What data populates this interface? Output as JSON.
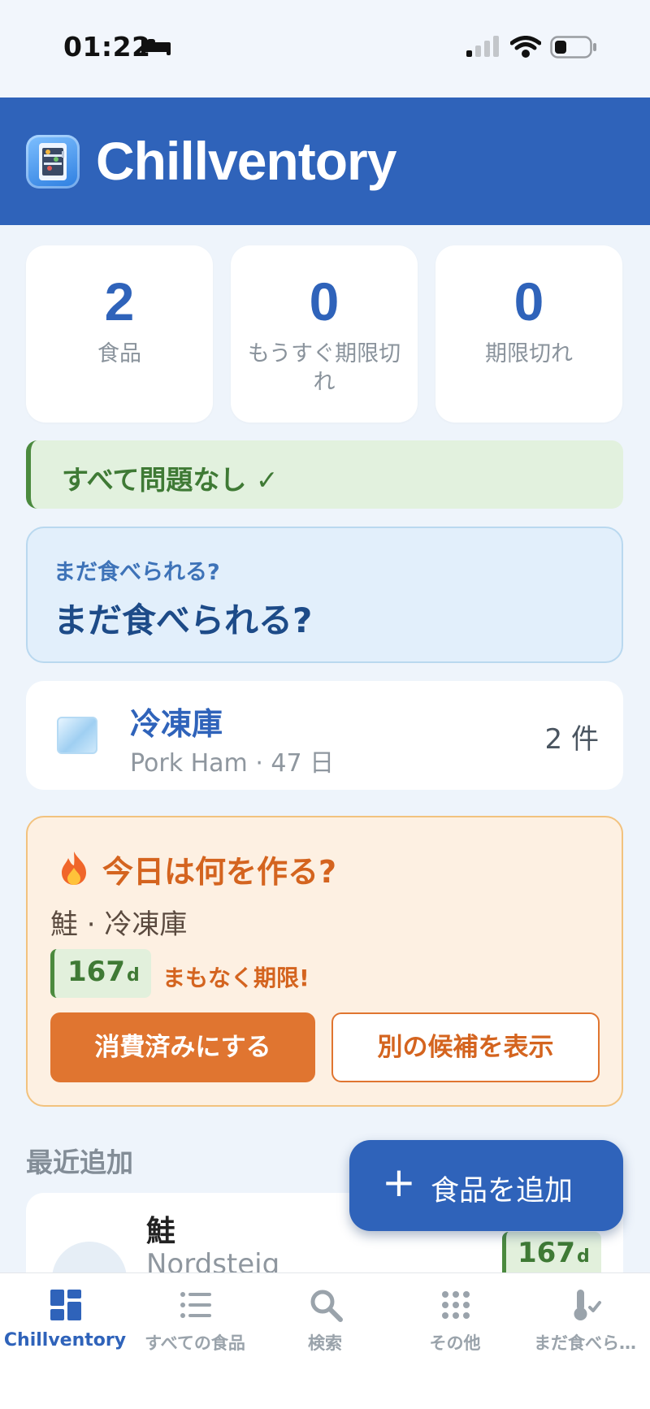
{
  "status_bar": {
    "time": "01:22"
  },
  "header": {
    "title": "Chillventory"
  },
  "stats": [
    {
      "value": "2",
      "label": "食品"
    },
    {
      "value": "0",
      "label": "もうすぐ期限切れ"
    },
    {
      "value": "0",
      "label": "期限切れ"
    }
  ],
  "status_banner": {
    "text": "すべて問題なし ✓",
    "color": "#3f7a35"
  },
  "edible_card": {
    "subtitle": "まだ食べられる?",
    "title": "まだ食べられる?"
  },
  "freezer": {
    "name": "冷凍庫",
    "subtitle": "Pork Ham · 47 日",
    "count": "2 件"
  },
  "cook_card": {
    "title": "今日は何を作る?",
    "item": "鮭 · 冷凍庫",
    "days": "167",
    "days_unit": "d",
    "warning": "まもなく期限!",
    "consume_button": "消費済みにする",
    "other_button": "別の候補を表示",
    "accent": "#e07530"
  },
  "recent": {
    "section_title": "最近追加",
    "items": [
      {
        "name": "鮭",
        "subtitle": "Nordsteig",
        "days": "167",
        "days_unit": "d"
      }
    ]
  },
  "fab": {
    "icon": "plus-icon",
    "label": "食品を追加"
  },
  "tabs": [
    {
      "label": "Chillventory",
      "icon": "dashboard-icon",
      "active": true
    },
    {
      "label": "すべての食品",
      "icon": "list-icon",
      "active": false
    },
    {
      "label": "検索",
      "icon": "search-icon",
      "active": false
    },
    {
      "label": "その他",
      "icon": "grid-dots-icon",
      "active": false
    },
    {
      "label": "まだ食べら…",
      "icon": "thermometer-check-icon",
      "active": false
    }
  ],
  "colors": {
    "primary": "#2f63ba",
    "success": "#4b8a3e",
    "warning": "#d4641f",
    "background": "#eef4fb"
  }
}
